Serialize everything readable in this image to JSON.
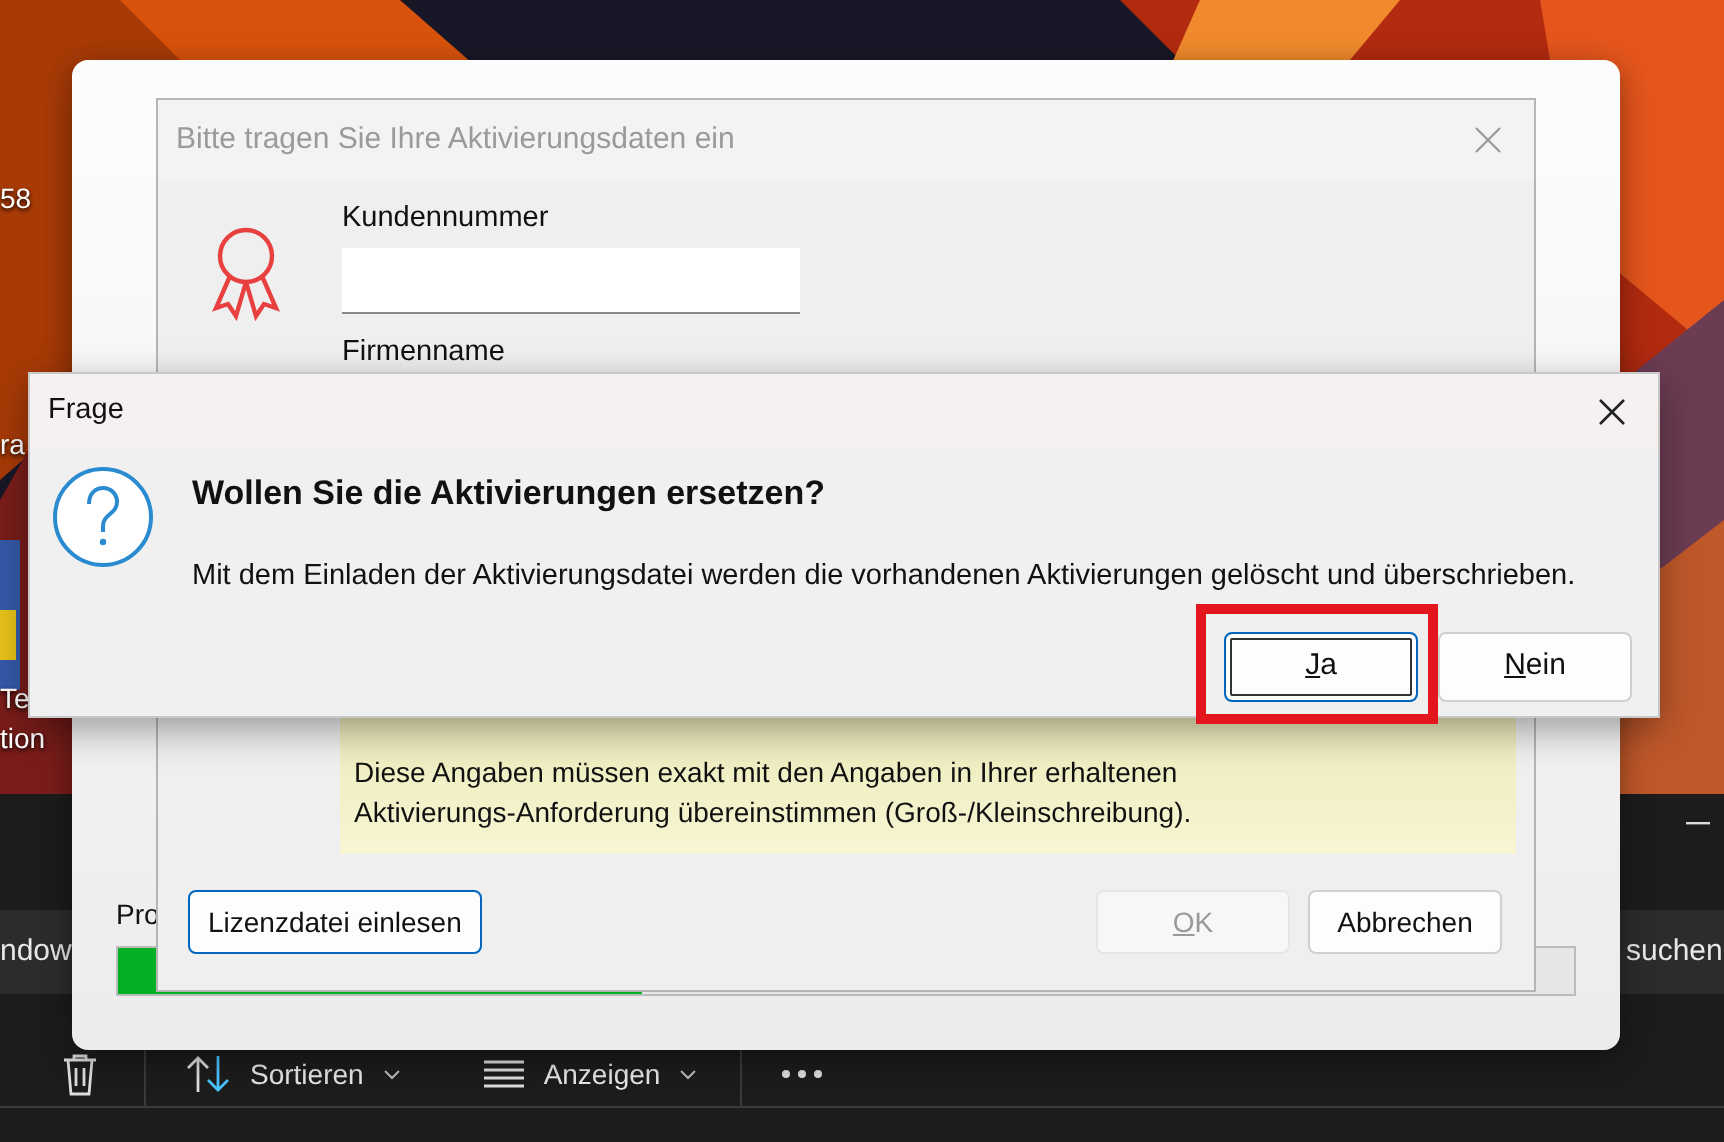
{
  "desktop": {
    "icon_labels": [
      "58",
      "ra",
      "Te",
      "tion"
    ]
  },
  "explorer": {
    "search_left": "ndow",
    "search_right": "suchen",
    "toolbar": [
      {
        "kind": "delete"
      },
      {
        "kind": "sort",
        "label": "Sortieren"
      },
      {
        "kind": "view",
        "label": "Anzeigen"
      },
      {
        "kind": "more"
      }
    ]
  },
  "progress_window": {
    "label": "Pro",
    "level": 0.36
  },
  "activation_dialog": {
    "title": "Bitte tragen Sie Ihre Aktivierungsdaten ein",
    "active": false,
    "fields": [
      {
        "kind": "input",
        "label": "Kundennummer"
      },
      {
        "kind": "label",
        "label": "Firmenname"
      }
    ],
    "note": "Diese Angaben müssen exakt mit den Angaben in Ihrer erhaltenen Aktivierungs-Anforderung übereinstimmen (Groß-/Kleinschreibung).",
    "buttons": [
      {
        "label": "Lizenzdatei einlesen",
        "disabled": false,
        "focused": true,
        "mnemonic": false
      },
      {
        "label": "OK",
        "disabled": true,
        "focused": false,
        "mnemonic": true
      },
      {
        "label": "Abbrechen",
        "disabled": false,
        "focused": false,
        "mnemonic": false
      }
    ]
  },
  "question_dialog": {
    "title": "Frage",
    "active": true,
    "heading": "Wollen Sie die Aktivierungen ersetzen?",
    "message": "Mit dem Einladen der Aktivierungsdatei werden die vorhandenen Aktivierungen gelöscht und überschrieben.",
    "buttons": [
      {
        "label": "Ja",
        "focused": true,
        "mnemonic": true,
        "highlighted": true
      },
      {
        "label": "Nein",
        "focused": false,
        "mnemonic": true,
        "highlighted": false
      }
    ]
  }
}
